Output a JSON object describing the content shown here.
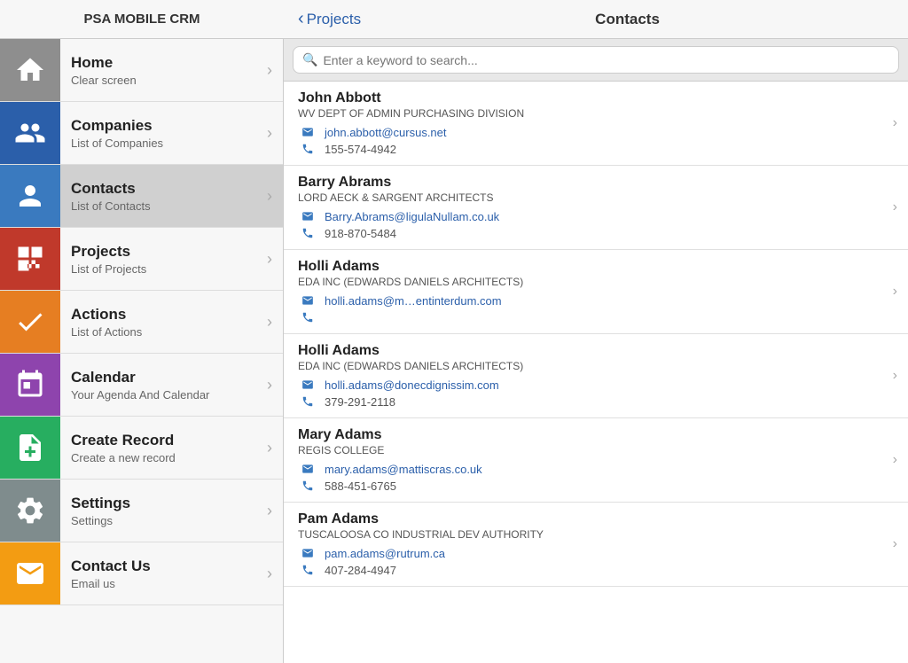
{
  "app": {
    "title": "PSA MOBILE CRM",
    "header": {
      "back_label": "Projects",
      "page_title": "Contacts"
    }
  },
  "sidebar": {
    "items": [
      {
        "id": "home",
        "icon": "home",
        "iconClass": "icon-home",
        "label": "Home",
        "sublabel": "Clear screen"
      },
      {
        "id": "companies",
        "icon": "companies",
        "iconClass": "icon-companies",
        "label": "Companies",
        "sublabel": "List of Companies"
      },
      {
        "id": "contacts",
        "icon": "contacts",
        "iconClass": "icon-contacts",
        "label": "Contacts",
        "sublabel": "List of Contacts",
        "active": true
      },
      {
        "id": "projects",
        "icon": "projects",
        "iconClass": "icon-projects",
        "label": "Projects",
        "sublabel": "List of Projects"
      },
      {
        "id": "actions",
        "icon": "actions",
        "iconClass": "icon-actions",
        "label": "Actions",
        "sublabel": "List of Actions"
      },
      {
        "id": "calendar",
        "icon": "calendar",
        "iconClass": "icon-calendar",
        "label": "Calendar",
        "sublabel": "Your Agenda And Calendar"
      },
      {
        "id": "create",
        "icon": "create",
        "iconClass": "icon-create",
        "label": "Create Record",
        "sublabel": "Create a new record"
      },
      {
        "id": "settings",
        "icon": "settings",
        "iconClass": "icon-settings",
        "label": "Settings",
        "sublabel": "Settings"
      },
      {
        "id": "contact-us",
        "icon": "contact-us",
        "iconClass": "icon-contact-us",
        "label": "Contact Us",
        "sublabel": "Email us"
      }
    ]
  },
  "search": {
    "placeholder": "Enter a keyword to search..."
  },
  "contacts": [
    {
      "name": "John Abbott",
      "company": "WV DEPT OF ADMIN PURCHASING DIVISION",
      "email": "john.abbott@cursus.net",
      "phone": "155-574-4942"
    },
    {
      "name": "Barry Abrams",
      "company": "LORD AECK & SARGENT ARCHITECTS",
      "email": "Barry.Abrams@ligulaNullam.co.uk",
      "phone": "918-870-5484"
    },
    {
      "name": "Holli Adams",
      "company": "EDA INC (EDWARDS DANIELS ARCHITECTS)",
      "email": "holli.adams@m…entinterdum.com",
      "phone": ""
    },
    {
      "name": "Holli Adams",
      "company": "EDA INC (EDWARDS DANIELS ARCHITECTS)",
      "email": "holli.adams@donecdignissim.com",
      "phone": "379-291-2118"
    },
    {
      "name": "Mary Adams",
      "company": "REGIS COLLEGE",
      "email": "mary.adams@mattiscras.co.uk",
      "phone": "588-451-6765"
    },
    {
      "name": "Pam Adams",
      "company": "TUSCALOOSA CO INDUSTRIAL DEV AUTHORITY",
      "email": "pam.adams@rutrum.ca",
      "phone": "407-284-4947"
    }
  ]
}
